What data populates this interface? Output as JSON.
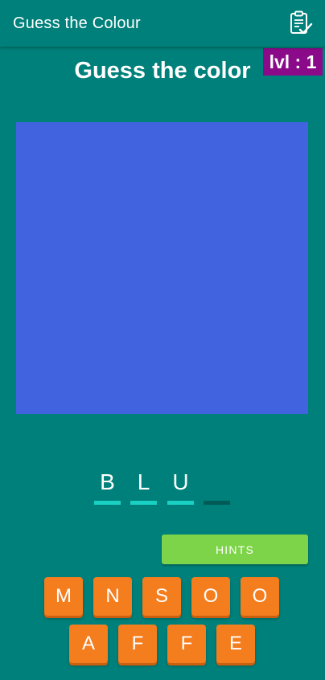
{
  "appbar": {
    "title": "Guess the Colour",
    "icon": "clipboard-check-icon"
  },
  "game": {
    "heading": "Guess the color",
    "level_label": "lvl : 1",
    "swatch_color": "#4163df",
    "answer_slots": [
      {
        "letter": "B",
        "filled": true
      },
      {
        "letter": "L",
        "filled": true
      },
      {
        "letter": "U",
        "filled": true
      },
      {
        "letter": "",
        "filled": false
      }
    ],
    "hints_label": "HINTS",
    "keyboard": {
      "row1": [
        "M",
        "N",
        "S",
        "O",
        "O"
      ],
      "row2": [
        "A",
        "F",
        "F",
        "E"
      ]
    }
  },
  "colors": {
    "background": "#00807a",
    "level_badge": "#8a0a89",
    "slot_filled": "#19d0c3",
    "slot_empty": "#005b57",
    "hints_button": "#7dd448",
    "key": "#f47d1e"
  }
}
